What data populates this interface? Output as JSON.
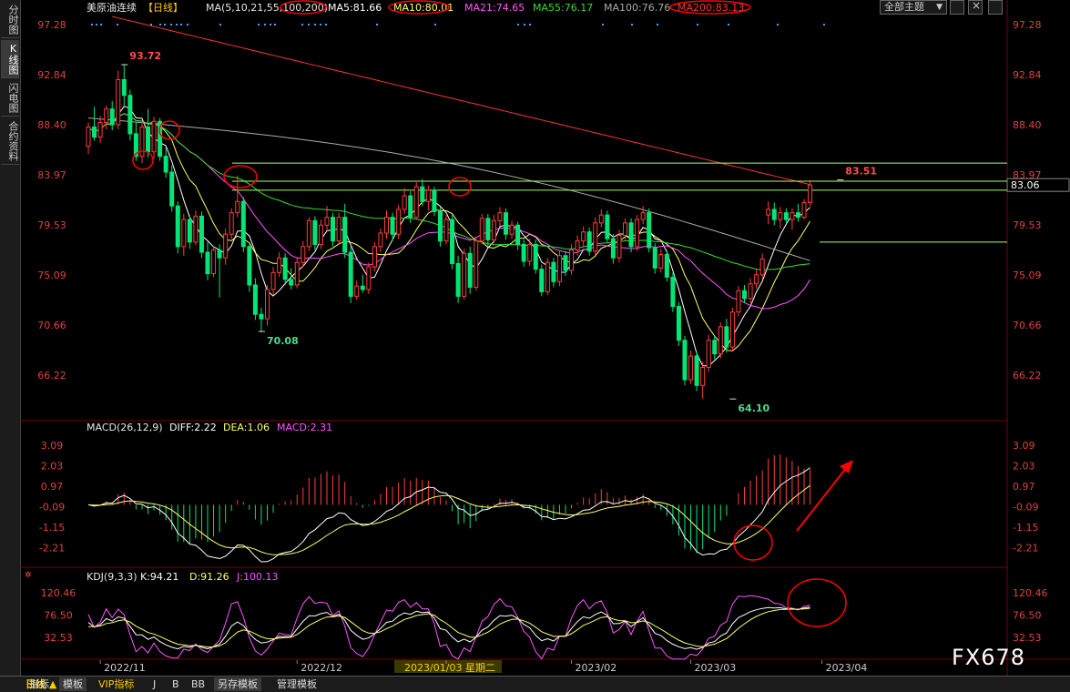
{
  "sidebar": {
    "tabs": [
      {
        "label": "分时图",
        "active": false
      },
      {
        "label": "K线图",
        "active": true
      },
      {
        "label": "闪电图",
        "active": false
      },
      {
        "label": "合约资料",
        "active": false
      }
    ]
  },
  "header": {
    "instrument": "美原油连续",
    "period": "【日线】",
    "ma_params": "MA(5,10,21,55,100,200)",
    "ma5": "MA5:81.66",
    "ma10": "MA10:80.01",
    "ma21": "MA21:74.65",
    "ma55": "MA55:76.17",
    "ma100": "MA100:76.76",
    "ma200": "MA200:83.13",
    "theme_button": "全部主题"
  },
  "macd_panel": {
    "title": "MACD(26,12,9)",
    "diff": "DIFF:2.22",
    "dea": "DEA:1.06",
    "macd": "MACD:2.31"
  },
  "kdj_panel": {
    "title": "KDJ(9,3,3)",
    "k": "K:94.21",
    "d": "D:91.26",
    "j": "J:100.13"
  },
  "bottom_bar": {
    "period_label": "日线 ▲",
    "tabs": [
      "指标",
      "模板",
      "VIP指标",
      "J",
      "B",
      "BB",
      "另存模板",
      "管理模板"
    ],
    "active_tab": "模板"
  },
  "watermark": "FX678",
  "colors": {
    "up": "#ff3c3c",
    "down": "#00e676",
    "ma5": "#ffffff",
    "ma10": "#ffff66",
    "ma21": "#ff55ff",
    "ma55": "#33dd33",
    "ma100": "#aaaaaa",
    "ma200": "#ff3333",
    "annotation": "#ff0000",
    "hline": "#aaff66"
  },
  "chart_data": [
    {
      "type": "candlestick",
      "title": "美原油连续 日线",
      "y_ticks": [
        97.28,
        92.84,
        88.4,
        83.97,
        79.53,
        75.09,
        70.66,
        66.22
      ],
      "ylim": [
        62.5,
        98.0
      ],
      "x_ticks": [
        {
          "label": "2022/11",
          "index": 2
        },
        {
          "label": "2022/12",
          "index": 35
        },
        {
          "label": "2023/01/03 星期二",
          "index": 60
        },
        {
          "label": "2023/02",
          "index": 81
        },
        {
          "label": "2023/03",
          "index": 101
        },
        {
          "label": "2023/04",
          "index": 123
        }
      ],
      "highlighted_x": "2023/01/03 星期二",
      "annotations": [
        {
          "text": "93.72",
          "index": 6,
          "price": 93.72,
          "kind": "high"
        },
        {
          "text": "70.08",
          "index": 29,
          "price": 70.08,
          "kind": "low"
        },
        {
          "text": "64.10",
          "index": 108,
          "price": 64.1,
          "kind": "low"
        },
        {
          "text": "83.51",
          "index": 126,
          "price": 83.51,
          "kind": "high"
        }
      ],
      "last_price_tag": "83.06",
      "horizontal_lines": [
        85.0,
        83.4,
        82.6,
        78.0
      ],
      "candles": [
        {
          "o": 86.5,
          "h": 88.6,
          "l": 85.8,
          "c": 88.2
        },
        {
          "o": 88.2,
          "h": 90.0,
          "l": 87.0,
          "c": 87.3
        },
        {
          "o": 87.3,
          "h": 89.2,
          "l": 86.8,
          "c": 88.6
        },
        {
          "o": 88.6,
          "h": 90.1,
          "l": 88.0,
          "c": 89.8
        },
        {
          "o": 89.8,
          "h": 90.5,
          "l": 87.9,
          "c": 88.4
        },
        {
          "o": 88.4,
          "h": 93.2,
          "l": 88.0,
          "c": 92.4
        },
        {
          "o": 92.4,
          "h": 93.72,
          "l": 90.1,
          "c": 91.0
        },
        {
          "o": 91.0,
          "h": 91.5,
          "l": 87.0,
          "c": 87.6
        },
        {
          "o": 87.6,
          "h": 88.6,
          "l": 85.2,
          "c": 85.6
        },
        {
          "o": 85.6,
          "h": 88.5,
          "l": 85.0,
          "c": 88.2
        },
        {
          "o": 88.2,
          "h": 89.8,
          "l": 85.5,
          "c": 86.0
        },
        {
          "o": 86.0,
          "h": 89.1,
          "l": 85.4,
          "c": 88.7
        },
        {
          "o": 88.7,
          "h": 89.0,
          "l": 85.2,
          "c": 85.6
        },
        {
          "o": 85.6,
          "h": 86.4,
          "l": 83.7,
          "c": 84.2
        },
        {
          "o": 84.2,
          "h": 84.8,
          "l": 80.7,
          "c": 81.2
        },
        {
          "o": 81.2,
          "h": 81.6,
          "l": 77.0,
          "c": 77.6
        },
        {
          "o": 77.6,
          "h": 80.5,
          "l": 76.8,
          "c": 80.0
        },
        {
          "o": 80.0,
          "h": 80.4,
          "l": 77.4,
          "c": 78.0
        },
        {
          "o": 78.0,
          "h": 80.8,
          "l": 77.7,
          "c": 80.3
        },
        {
          "o": 80.3,
          "h": 80.7,
          "l": 76.6,
          "c": 77.1
        },
        {
          "o": 77.1,
          "h": 78.0,
          "l": 74.6,
          "c": 75.2
        },
        {
          "o": 75.2,
          "h": 77.6,
          "l": 74.9,
          "c": 77.3
        },
        {
          "o": 77.3,
          "h": 77.8,
          "l": 73.1,
          "c": 76.6
        },
        {
          "o": 76.6,
          "h": 79.2,
          "l": 76.0,
          "c": 78.7
        },
        {
          "o": 78.7,
          "h": 81.0,
          "l": 78.3,
          "c": 80.6
        },
        {
          "o": 80.6,
          "h": 83.9,
          "l": 80.2,
          "c": 81.6
        },
        {
          "o": 81.6,
          "h": 82.0,
          "l": 77.1,
          "c": 77.6
        },
        {
          "o": 77.6,
          "h": 77.8,
          "l": 73.6,
          "c": 74.2
        },
        {
          "o": 74.2,
          "h": 74.8,
          "l": 71.1,
          "c": 71.6
        },
        {
          "o": 71.6,
          "h": 72.2,
          "l": 70.08,
          "c": 71.2
        },
        {
          "o": 71.2,
          "h": 74.2,
          "l": 70.6,
          "c": 73.8
        },
        {
          "o": 73.8,
          "h": 75.8,
          "l": 73.3,
          "c": 75.3
        },
        {
          "o": 75.3,
          "h": 77.1,
          "l": 74.9,
          "c": 76.6
        },
        {
          "o": 76.6,
          "h": 77.0,
          "l": 74.2,
          "c": 74.7
        },
        {
          "o": 74.7,
          "h": 75.7,
          "l": 73.8,
          "c": 74.2
        },
        {
          "o": 74.2,
          "h": 76.7,
          "l": 73.9,
          "c": 76.2
        },
        {
          "o": 76.2,
          "h": 78.1,
          "l": 75.8,
          "c": 77.6
        },
        {
          "o": 77.6,
          "h": 80.2,
          "l": 77.2,
          "c": 79.9
        },
        {
          "o": 79.9,
          "h": 80.3,
          "l": 77.3,
          "c": 77.8
        },
        {
          "o": 77.8,
          "h": 80.0,
          "l": 77.4,
          "c": 79.5
        },
        {
          "o": 79.5,
          "h": 81.2,
          "l": 79.0,
          "c": 80.2
        },
        {
          "o": 80.2,
          "h": 80.6,
          "l": 77.6,
          "c": 78.1
        },
        {
          "o": 78.1,
          "h": 80.6,
          "l": 77.9,
          "c": 80.2
        },
        {
          "o": 80.2,
          "h": 81.4,
          "l": 76.6,
          "c": 77.1
        },
        {
          "o": 77.1,
          "h": 77.6,
          "l": 72.6,
          "c": 73.2
        },
        {
          "o": 73.2,
          "h": 74.6,
          "l": 72.9,
          "c": 74.1
        },
        {
          "o": 74.1,
          "h": 75.1,
          "l": 73.5,
          "c": 73.8
        },
        {
          "o": 73.8,
          "h": 76.2,
          "l": 73.4,
          "c": 75.8
        },
        {
          "o": 75.8,
          "h": 78.0,
          "l": 75.4,
          "c": 77.6
        },
        {
          "o": 77.6,
          "h": 79.2,
          "l": 77.1,
          "c": 78.8
        },
        {
          "o": 78.8,
          "h": 80.8,
          "l": 78.3,
          "c": 80.2
        },
        {
          "o": 80.2,
          "h": 80.6,
          "l": 78.1,
          "c": 78.7
        },
        {
          "o": 78.7,
          "h": 81.3,
          "l": 78.3,
          "c": 80.9
        },
        {
          "o": 80.9,
          "h": 82.8,
          "l": 80.5,
          "c": 82.1
        },
        {
          "o": 82.1,
          "h": 82.5,
          "l": 79.7,
          "c": 80.2
        },
        {
          "o": 80.2,
          "h": 83.3,
          "l": 80.0,
          "c": 82.9
        },
        {
          "o": 82.9,
          "h": 83.6,
          "l": 81.2,
          "c": 81.6
        },
        {
          "o": 81.6,
          "h": 83.0,
          "l": 80.8,
          "c": 82.6
        },
        {
          "o": 82.6,
          "h": 82.9,
          "l": 80.3,
          "c": 80.7
        },
        {
          "o": 80.7,
          "h": 81.1,
          "l": 77.6,
          "c": 78.1
        },
        {
          "o": 78.1,
          "h": 80.4,
          "l": 77.8,
          "c": 80.0
        },
        {
          "o": 80.0,
          "h": 80.4,
          "l": 75.6,
          "c": 76.1
        },
        {
          "o": 76.1,
          "h": 76.8,
          "l": 72.6,
          "c": 73.2
        },
        {
          "o": 73.2,
          "h": 77.4,
          "l": 72.9,
          "c": 77.0
        },
        {
          "o": 77.0,
          "h": 77.6,
          "l": 73.4,
          "c": 74.0
        },
        {
          "o": 74.0,
          "h": 78.5,
          "l": 73.7,
          "c": 78.1
        },
        {
          "o": 78.1,
          "h": 80.5,
          "l": 77.8,
          "c": 80.1
        },
        {
          "o": 80.1,
          "h": 80.5,
          "l": 77.6,
          "c": 78.2
        },
        {
          "o": 78.2,
          "h": 80.4,
          "l": 77.9,
          "c": 79.9
        },
        {
          "o": 79.9,
          "h": 81.1,
          "l": 79.4,
          "c": 80.6
        },
        {
          "o": 80.6,
          "h": 81.0,
          "l": 78.2,
          "c": 78.7
        },
        {
          "o": 78.7,
          "h": 79.9,
          "l": 78.3,
          "c": 79.5
        },
        {
          "o": 79.5,
          "h": 79.8,
          "l": 77.3,
          "c": 77.8
        },
        {
          "o": 77.8,
          "h": 78.2,
          "l": 75.8,
          "c": 76.3
        },
        {
          "o": 76.3,
          "h": 78.3,
          "l": 75.9,
          "c": 77.8
        },
        {
          "o": 77.8,
          "h": 78.2,
          "l": 75.2,
          "c": 75.6
        },
        {
          "o": 75.6,
          "h": 76.0,
          "l": 73.2,
          "c": 73.6
        },
        {
          "o": 73.6,
          "h": 76.6,
          "l": 73.3,
          "c": 76.2
        },
        {
          "o": 76.2,
          "h": 76.6,
          "l": 74.0,
          "c": 74.5
        },
        {
          "o": 74.5,
          "h": 77.3,
          "l": 74.1,
          "c": 76.8
        },
        {
          "o": 76.8,
          "h": 77.2,
          "l": 75.0,
          "c": 75.5
        },
        {
          "o": 75.5,
          "h": 77.8,
          "l": 75.1,
          "c": 77.3
        },
        {
          "o": 77.3,
          "h": 78.6,
          "l": 76.8,
          "c": 78.1
        },
        {
          "o": 78.1,
          "h": 79.4,
          "l": 77.6,
          "c": 78.9
        },
        {
          "o": 78.9,
          "h": 79.3,
          "l": 76.8,
          "c": 77.2
        },
        {
          "o": 77.2,
          "h": 80.2,
          "l": 76.8,
          "c": 79.7
        },
        {
          "o": 79.7,
          "h": 80.9,
          "l": 79.3,
          "c": 80.4
        },
        {
          "o": 80.4,
          "h": 80.8,
          "l": 77.9,
          "c": 78.3
        },
        {
          "o": 78.3,
          "h": 78.7,
          "l": 76.1,
          "c": 76.6
        },
        {
          "o": 76.6,
          "h": 79.1,
          "l": 76.2,
          "c": 78.6
        },
        {
          "o": 78.6,
          "h": 80.1,
          "l": 78.2,
          "c": 79.7
        },
        {
          "o": 79.7,
          "h": 80.1,
          "l": 77.1,
          "c": 77.6
        },
        {
          "o": 77.6,
          "h": 80.4,
          "l": 77.2,
          "c": 80.0
        },
        {
          "o": 80.0,
          "h": 81.2,
          "l": 79.6,
          "c": 80.6
        },
        {
          "o": 80.6,
          "h": 81.0,
          "l": 77.1,
          "c": 77.5
        },
        {
          "o": 77.5,
          "h": 77.9,
          "l": 75.2,
          "c": 75.7
        },
        {
          "o": 75.7,
          "h": 77.4,
          "l": 75.3,
          "c": 76.9
        },
        {
          "o": 76.9,
          "h": 77.3,
          "l": 74.5,
          "c": 74.9
        },
        {
          "o": 74.9,
          "h": 75.3,
          "l": 71.8,
          "c": 72.3
        },
        {
          "o": 72.3,
          "h": 72.7,
          "l": 68.8,
          "c": 69.3
        },
        {
          "o": 69.3,
          "h": 69.7,
          "l": 65.3,
          "c": 65.8
        },
        {
          "o": 65.8,
          "h": 68.4,
          "l": 65.4,
          "c": 67.9
        },
        {
          "o": 67.9,
          "h": 68.3,
          "l": 64.8,
          "c": 65.3
        },
        {
          "o": 65.3,
          "h": 67.4,
          "l": 64.1,
          "c": 66.9
        },
        {
          "o": 66.9,
          "h": 69.8,
          "l": 66.5,
          "c": 69.3
        },
        {
          "o": 69.3,
          "h": 69.7,
          "l": 67.6,
          "c": 68.1
        },
        {
          "o": 68.1,
          "h": 70.9,
          "l": 67.7,
          "c": 70.5
        },
        {
          "o": 70.5,
          "h": 71.2,
          "l": 68.2,
          "c": 68.7
        },
        {
          "o": 68.7,
          "h": 72.2,
          "l": 68.3,
          "c": 71.8
        },
        {
          "o": 71.8,
          "h": 74.1,
          "l": 71.4,
          "c": 73.7
        },
        {
          "o": 73.7,
          "h": 74.2,
          "l": 72.6,
          "c": 73.0
        },
        {
          "o": 73.0,
          "h": 74.8,
          "l": 72.6,
          "c": 74.3
        },
        {
          "o": 74.3,
          "h": 75.6,
          "l": 73.9,
          "c": 75.1
        },
        {
          "o": 75.1,
          "h": 77.0,
          "l": 74.7,
          "c": 76.5
        },
        {
          "o": 80.4,
          "h": 81.6,
          "l": 79.6,
          "c": 80.9
        },
        {
          "o": 80.9,
          "h": 81.5,
          "l": 79.5,
          "c": 80.0
        },
        {
          "o": 80.0,
          "h": 81.1,
          "l": 79.2,
          "c": 80.6
        },
        {
          "o": 80.6,
          "h": 81.0,
          "l": 79.6,
          "c": 80.0
        },
        {
          "o": 80.0,
          "h": 81.0,
          "l": 79.1,
          "c": 80.6
        },
        {
          "o": 80.6,
          "h": 81.4,
          "l": 79.8,
          "c": 80.2
        },
        {
          "o": 80.2,
          "h": 81.8,
          "l": 80.0,
          "c": 81.5
        },
        {
          "o": 81.5,
          "h": 83.51,
          "l": 81.2,
          "c": 83.06
        }
      ]
    },
    {
      "type": "macd",
      "title": "MACD(26,12,9)",
      "y_ticks": [
        3.09,
        2.03,
        0.97,
        -0.09,
        -1.15,
        -2.21
      ],
      "ylim": [
        -2.9,
        3.6
      ]
    },
    {
      "type": "kdj",
      "title": "KDJ(9,3,3)",
      "y_ticks": [
        120.46,
        76.5,
        32.53
      ],
      "ylim": [
        -12,
        140
      ]
    }
  ]
}
